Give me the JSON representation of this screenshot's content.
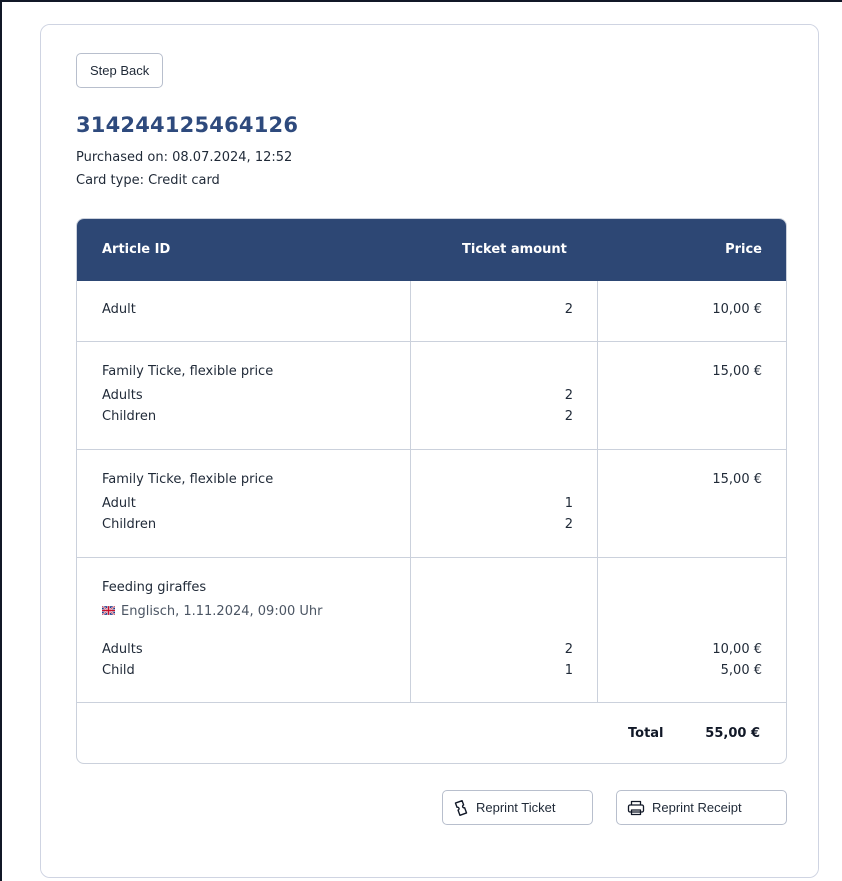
{
  "nav": {
    "back_label": "Step Back"
  },
  "order": {
    "id": "314244125464126",
    "purchased": "Purchased on: 08.07.2024, 12:52",
    "card_type": "Card type: Credit card"
  },
  "table": {
    "headers": {
      "article": "Article ID",
      "amount": "Ticket amount",
      "price": "Price"
    },
    "rows": [
      {
        "title": "Adult",
        "amount": "2",
        "price": "10,00 €"
      },
      {
        "title": "Family Ticke, flexible price",
        "price": "15,00 €",
        "lines": [
          {
            "label": "Adults",
            "amount": "2"
          },
          {
            "label": "Children",
            "amount": "2"
          }
        ]
      },
      {
        "title": "Family Ticke, flexible price",
        "price": "15,00 €",
        "lines": [
          {
            "label": "Adult",
            "amount": "1"
          },
          {
            "label": "Children",
            "amount": "2"
          }
        ]
      },
      {
        "title": "Feeding giraffes",
        "subtitle": "Englisch, 1.11.2024, 09:00 Uhr",
        "flag_icon": "uk-flag-icon",
        "lines": [
          {
            "label": "Adults",
            "amount": "2",
            "price": "10,00 €"
          },
          {
            "label": "Child",
            "amount": "1",
            "price": "5,00 €"
          }
        ]
      }
    ],
    "total_label": "Total",
    "total_value": "55,00 €"
  },
  "actions": {
    "reprint_ticket": "Reprint Ticket",
    "reprint_ticket_icon": "ticket-icon",
    "reprint_receipt": "Reprint Receipt",
    "reprint_receipt_icon": "printer-icon"
  },
  "colors": {
    "header_bg": "#2d4774",
    "title": "#2e4a7d",
    "page_bg": "#f1f3fc"
  }
}
